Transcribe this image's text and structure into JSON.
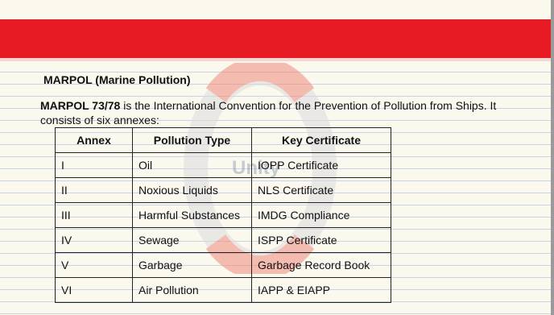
{
  "page": {
    "title": "MARPOL (Marine Pollution)",
    "intro_bold": "MARPOL 73/78",
    "intro_text": " is the International Convention for the Prevention of Pollution from Ships. It consists of six annexes:"
  },
  "table": {
    "headers": [
      "Annex",
      "Pollution Type",
      "Key Certificate"
    ],
    "rows": [
      [
        "I",
        "Oil",
        "IOPP Certificate"
      ],
      [
        "II",
        "Noxious Liquids",
        "NLS Certificate"
      ],
      [
        "III",
        "Harmful Substances",
        "IMDG Compliance"
      ],
      [
        "IV",
        "Sewage",
        "ISPP Certificate"
      ],
      [
        "V",
        "Garbage",
        "Garbage Record Book"
      ],
      [
        "VI",
        "Air Pollution",
        "IAPP & EIAPP"
      ]
    ]
  },
  "watermark": {
    "icon": "lifebuoy-icon",
    "text": "Unity"
  },
  "colors": {
    "band": "#e61b24",
    "paper": "#fbf8ee",
    "ruled_line": "#c8d3ea"
  }
}
